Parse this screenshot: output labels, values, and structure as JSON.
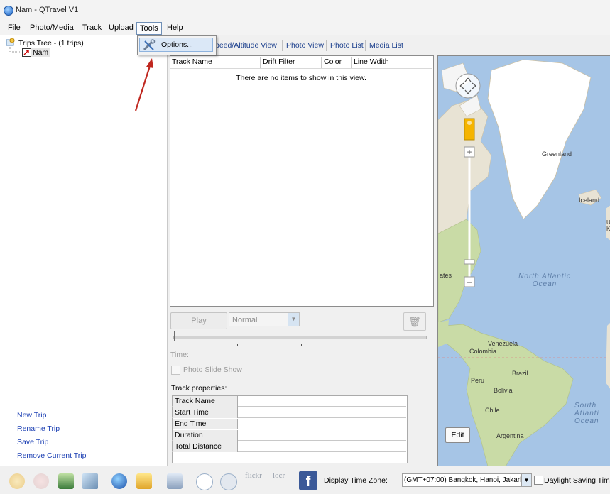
{
  "window": {
    "title": "Nam - QTravel V1"
  },
  "menu": {
    "file": "File",
    "photo_media": "Photo/Media",
    "track": "Track",
    "upload": "Upload",
    "tools": "Tools",
    "help": "Help"
  },
  "tools_menu": {
    "options": "Options..."
  },
  "tree": {
    "root": "Trips Tree - (1 trips)",
    "child": "Nam"
  },
  "trip_actions": {
    "new": "New Trip",
    "rename": "Rename Trip",
    "save": "Save Trip",
    "remove": "Remove Current Trip"
  },
  "tabs": [
    "peed/Altitude View",
    "Photo View",
    "Photo List",
    "Media List"
  ],
  "track_list": {
    "columns": [
      "Track Name",
      "Drift Filter",
      "Color",
      "Line Wdith"
    ],
    "empty_message": "There are no items to show in this view."
  },
  "playback": {
    "play_label": "Play",
    "speed_value": "Normal",
    "time_label": "Time:",
    "slide_show_label": "Photo Slide Show"
  },
  "track_properties": {
    "label": "Track properties:",
    "rows": [
      "Track Name",
      "Start Time",
      "End Time",
      "Duration",
      "Total Distance"
    ]
  },
  "map": {
    "labels": {
      "greenland": "Greenland",
      "iceland": "Iceland",
      "venezuela": "Venezuela",
      "colombia": "Colombia",
      "brazil": "Brazil",
      "peru": "Peru",
      "bolivia": "Bolivia",
      "chile": "Chile",
      "argentina": "Argentina",
      "states_fragment": "ates",
      "right_edge_fragment": "U K"
    },
    "north_atlantic": "North Atlantic Ocean",
    "south_atlantic": "South Atlanti Ocean",
    "edit_label": "Edit",
    "colors": {
      "water": "#a6c5e6",
      "land": "#e8e3d4",
      "green": "#c9dba6",
      "ice": "#ffffff"
    }
  },
  "toolbar": {
    "icons": [
      "photo-sun-icon",
      "record-icon",
      "scanner-icon",
      "satellite-icon",
      "globe-icon",
      "folder-open-icon",
      "photo-import-icon",
      "clock-icon",
      "camera-icon",
      "flickr-icon",
      "locr-icon",
      "facebook-icon"
    ],
    "flickr_text": "flickr",
    "locr_text": "locr",
    "facebook_text": "f",
    "timezone_label": "Display Time Zone:",
    "timezone_value": "(GMT+07:00) Bangkok, Hanoi, Jakarl",
    "dst_label": "Daylight Saving Time"
  }
}
